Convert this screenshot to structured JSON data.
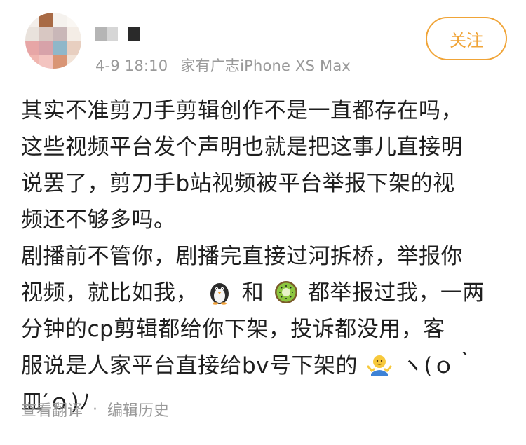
{
  "post": {
    "meta": {
      "time": "4-9 18:10",
      "source": "家有广志iPhone XS Max"
    },
    "follow_label": "关注",
    "content": {
      "line1": "其实不准剪刀手剪辑创作不是一直都存在吗，",
      "line2": "这些视频平台发个声明也就是把这事儿直接明",
      "line3": "说罢了，剪刀手b站视频被平台举报下架的视",
      "line4": "频还不够多吗。",
      "line5": "剧播前不管你，剧播完直接过河拆桥，举报你",
      "line6_a": "视频，就比如我，",
      "line6_b": "和",
      "line6_c": "都举报过我，一两",
      "line7": "分钟的cp剪辑都给你下架，投诉都没用，客",
      "line8_a": "服说是人家平台直接给bv号下架的",
      "line8_b": "ヽ(ｏ｀",
      "line9": "皿′ｏ)ﾉ"
    },
    "footer": {
      "translate": "查看翻译",
      "separator": "·",
      "edit_history": "编辑历史"
    }
  },
  "icons": {
    "emoji1": "penguin-icon",
    "emoji2": "kiwi-icon",
    "emoji3": "shrug-icon"
  },
  "colors": {
    "accent": "#f0a437",
    "meta_text": "#9a9a9a",
    "body_text": "#1f1f1f"
  }
}
